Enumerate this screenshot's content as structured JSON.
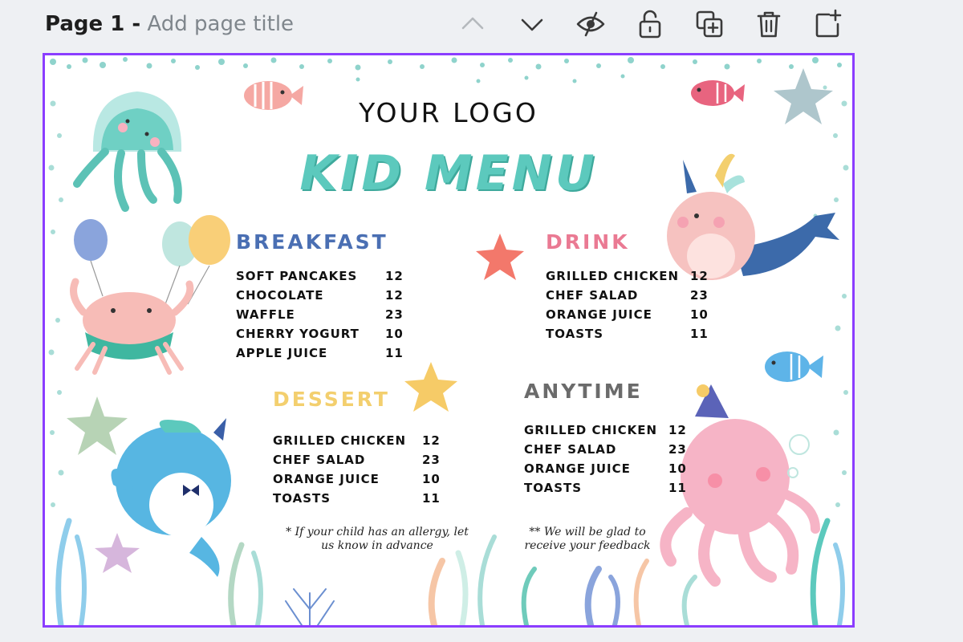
{
  "header": {
    "page_number": "Page 1 -",
    "page_title_placeholder": "Add page title"
  },
  "toolbar": {
    "icons": [
      "chevron-up-icon",
      "chevron-down-icon",
      "eye-off-icon",
      "unlock-icon",
      "duplicate-page-icon",
      "trash-icon",
      "add-page-icon"
    ]
  },
  "canvas": {
    "logo": "YOUR LOGO",
    "title": "KID MENU",
    "sections": [
      {
        "heading": "BREAKFAST",
        "color": "#4a6fb3",
        "items": [
          {
            "name": "SOFT PANCAKES",
            "price": "12"
          },
          {
            "name": "CHOCOLATE",
            "price": "12"
          },
          {
            "name": "WAFFLE",
            "price": "23"
          },
          {
            "name": "CHERRY YOGURT",
            "price": "10"
          },
          {
            "name": "APPLE JUICE",
            "price": "11"
          }
        ]
      },
      {
        "heading": "DRINK",
        "color": "#ea7a93",
        "items": [
          {
            "name": "GRILLED CHICKEN",
            "price": "12"
          },
          {
            "name": "CHEF SALAD",
            "price": "23"
          },
          {
            "name": "ORANGE JUICE",
            "price": "10"
          },
          {
            "name": "TOASTS",
            "price": "11"
          }
        ]
      },
      {
        "heading": "DESSERT",
        "color": "#f3cf6e",
        "items": [
          {
            "name": "GRILLED CHICKEN",
            "price": "12"
          },
          {
            "name": "CHEF SALAD",
            "price": "23"
          },
          {
            "name": "ORANGE JUICE",
            "price": "10"
          },
          {
            "name": "TOASTS",
            "price": "11"
          }
        ]
      },
      {
        "heading": "ANYTIME",
        "color": "#6b6b6b",
        "items": [
          {
            "name": "GRILLED CHICKEN",
            "price": "12"
          },
          {
            "name": "CHEF SALAD",
            "price": "23"
          },
          {
            "name": "ORANGE JUICE",
            "price": "10"
          },
          {
            "name": "TOASTS",
            "price": "11"
          }
        ]
      }
    ],
    "notes": {
      "allergy": "* If your child has an allergy, let us know in advance",
      "feedback": "** We will be glad to receive your feedback"
    }
  },
  "colors": {
    "selection_border": "#8b3dff",
    "title_teal": "#5cc9bd",
    "toolbar_icon": "#3a3a3a",
    "toolbar_icon_disabled": "#b5b9bd"
  }
}
